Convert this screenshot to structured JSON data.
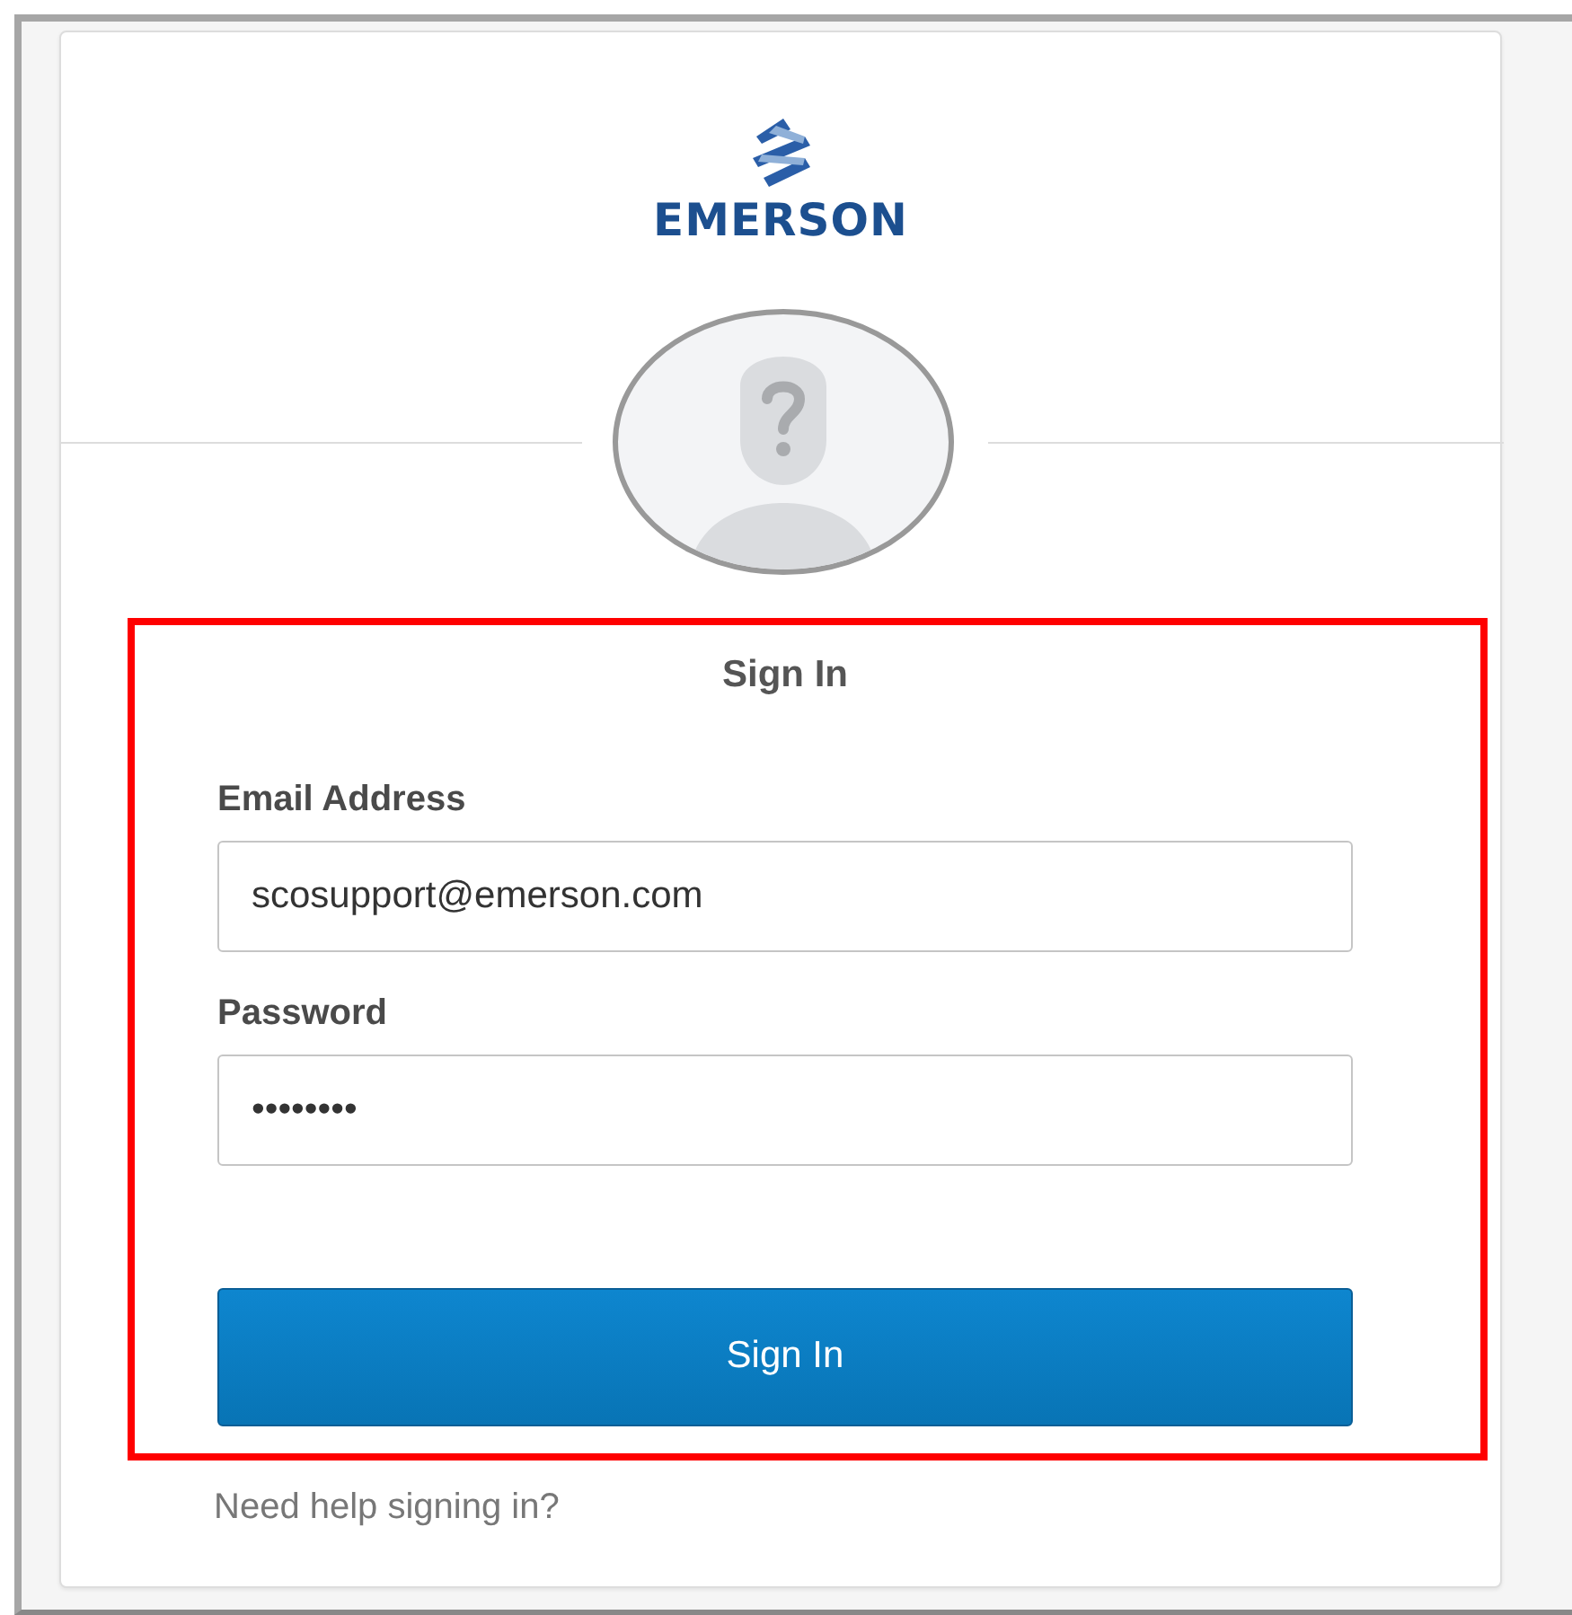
{
  "logo": {
    "text": "EMERSON"
  },
  "form": {
    "title": "Sign In",
    "fields": [
      {
        "label": "Email Address",
        "value": "scosupport@emerson.com"
      },
      {
        "label": "Password",
        "value": "••••••••"
      }
    ],
    "button": "Sign In"
  },
  "help_link": "Need help signing in?"
}
